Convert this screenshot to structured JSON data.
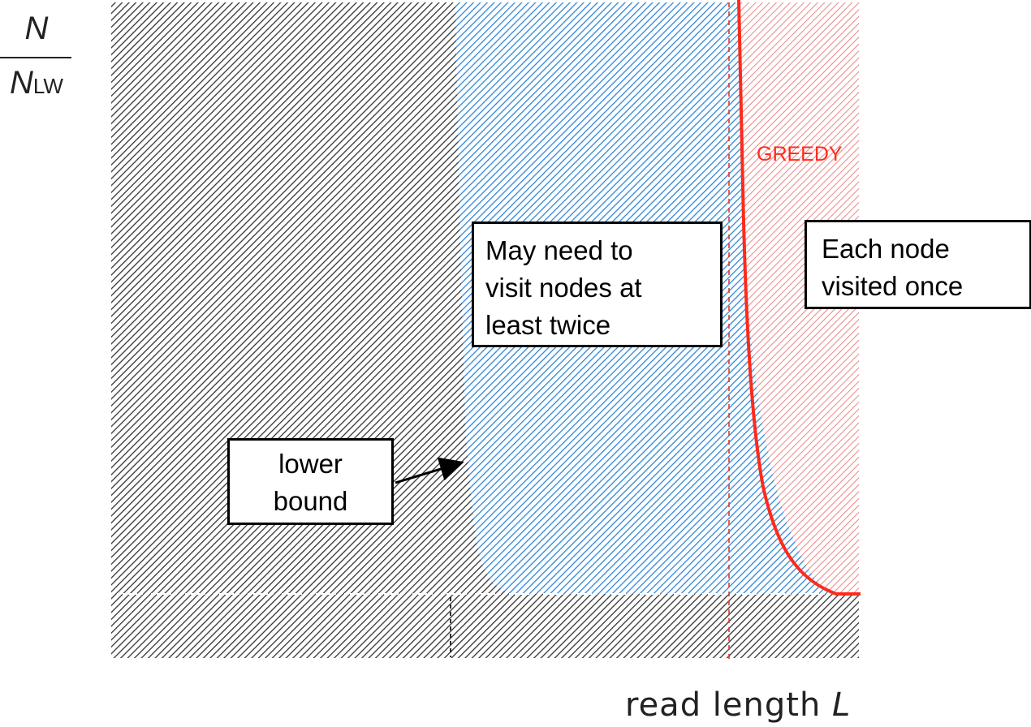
{
  "axes": {
    "y_numerator": "N",
    "y_denominator": "N",
    "y_denominator_sub": "LW",
    "x_label_text": "read length",
    "x_label_var": "L"
  },
  "regions": {
    "middle_box_lines": [
      "May need to",
      "visit nodes at",
      "least twice"
    ],
    "right_box_lines": [
      "Each node",
      "visited once"
    ],
    "lower_bound_lines": [
      "lower",
      "bound"
    ]
  },
  "curve_label": "GREEDY",
  "colors": {
    "black_hatch": "#333333",
    "blue_hatch": "#2f86d8",
    "red_hatch": "#e87878",
    "greedy_curve": "#ff2a1a",
    "box_border": "#000000"
  }
}
